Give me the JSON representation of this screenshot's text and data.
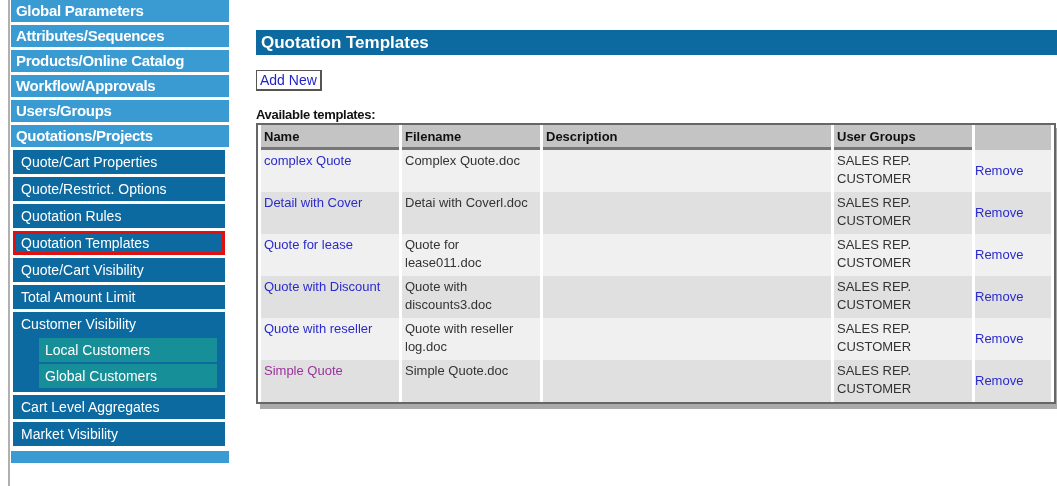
{
  "sidebar": {
    "items": [
      {
        "label": "Global Parameters",
        "selected": false
      },
      {
        "label": "Attributes/Sequences",
        "selected": false
      },
      {
        "label": "Products/Online Catalog",
        "selected": false
      },
      {
        "label": "Workflow/Approvals",
        "selected": false
      },
      {
        "label": "Users/Groups",
        "selected": false
      },
      {
        "label": "Quotations/Projects",
        "selected": false,
        "children": [
          {
            "label": "Quote/Cart Properties",
            "selected": false
          },
          {
            "label": "Quote/Restrict. Options",
            "selected": false
          },
          {
            "label": "Quotation Rules",
            "selected": false
          },
          {
            "label": "Quotation Templates",
            "selected": true
          },
          {
            "label": "Quote/Cart Visibility",
            "selected": false
          },
          {
            "label": "Total Amount Limit",
            "selected": false
          },
          {
            "label": "Customer Visibility",
            "selected": false,
            "children": [
              {
                "label": "Local Customers",
                "selected": false
              },
              {
                "label": "Global Customers",
                "selected": false
              }
            ]
          },
          {
            "label": "Cart Level Aggregates",
            "selected": false
          },
          {
            "label": "Market Visibility",
            "selected": false
          }
        ]
      }
    ]
  },
  "page": {
    "title": "Quotation Templates",
    "add_button": "Add New",
    "table_caption": "Available templates:"
  },
  "table": {
    "columns": [
      "Name",
      "Filename",
      "Description",
      "User Groups"
    ],
    "rows": [
      {
        "name": "complex Quote",
        "visited": false,
        "filename": "Complex Quote.doc",
        "user_groups": [
          "SALES REP.",
          "CUSTOMER"
        ],
        "action": "Remove"
      },
      {
        "name": "Detail with Cover",
        "visited": false,
        "filename": "Detai with Coverl.doc",
        "user_groups": [
          "SALES REP.",
          "CUSTOMER"
        ],
        "action": "Remove"
      },
      {
        "name": "Quote for lease",
        "visited": false,
        "filename": "Quote for lease011.doc",
        "user_groups": [
          "SALES REP.",
          "CUSTOMER"
        ],
        "action": "Remove"
      },
      {
        "name": "Quote with Discount",
        "visited": false,
        "filename": "Quote with discounts3.doc",
        "user_groups": [
          "SALES REP.",
          "CUSTOMER"
        ],
        "action": "Remove"
      },
      {
        "name": "Quote with reseller",
        "visited": false,
        "filename": "Quote with reseller log.doc",
        "user_groups": [
          "SALES REP.",
          "CUSTOMER"
        ],
        "action": "Remove"
      },
      {
        "name": "Simple Quote",
        "visited": true,
        "filename": "Simple Quote.doc",
        "user_groups": [
          "SALES REP.",
          "CUSTOMER"
        ],
        "action": "Remove"
      }
    ]
  }
}
